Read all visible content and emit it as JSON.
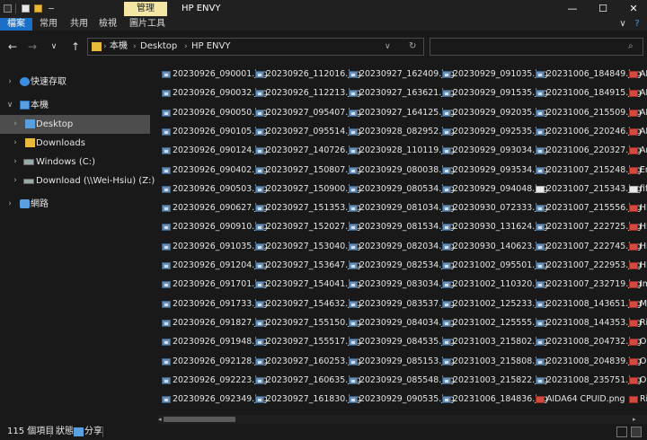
{
  "window": {
    "title": "HP ENVY",
    "manage_tab": "管理",
    "minimize": "—",
    "maximize": "☐",
    "close": "✕"
  },
  "ribbon": {
    "tabs": [
      "檔案",
      "常用",
      "共用",
      "檢視",
      "圖片工具"
    ],
    "expand": "∨",
    "help": "?"
  },
  "nav": {
    "back": "←",
    "forward": "→",
    "recent": "∨",
    "up": "↑",
    "breadcrumbs": [
      "本機",
      "Desktop",
      "HP ENVY"
    ],
    "crumb_sep": "›",
    "dropdown": "∨",
    "refresh": "↻",
    "search_icon": "⌕"
  },
  "sidebar": {
    "items": [
      {
        "label": "快速存取",
        "icon": "star-icon",
        "chevron": "›"
      },
      {
        "label": "本機",
        "icon": "computer-icon",
        "chevron": "∨"
      },
      {
        "label": "Desktop",
        "icon": "folder-icon",
        "chevron": "›"
      },
      {
        "label": "Downloads",
        "icon": "folder-icon",
        "chevron": "›"
      },
      {
        "label": "Windows (C:)",
        "icon": "drive-icon",
        "chevron": "›"
      },
      {
        "label": "Download (\\\\Wei-Hsiu) (Z:)",
        "icon": "network-drive-icon",
        "chevron": "›"
      },
      {
        "label": "網路",
        "icon": "network-icon",
        "chevron": "›"
      }
    ]
  },
  "files": {
    "columns": [
      [
        "20230926_090001.jpg",
        "20230926_090032.jpg",
        "20230926_090050.jpg",
        "20230926_090105.jpg",
        "20230926_090124.jpg",
        "20230926_090402.jpg",
        "20230926_090503.jpg",
        "20230926_090627.jpg",
        "20230926_090910.jpg",
        "20230926_091035.jpg",
        "20230926_091204.jpg",
        "20230926_091701.jpg",
        "20230926_091733.jpg",
        "20230926_091827.jpg",
        "20230926_091948.jpg",
        "20230926_092128.jpg",
        "20230926_092223.jpg",
        "20230926_092349.jpg"
      ],
      [
        "20230926_112016.jpg",
        "20230926_112213.jpg",
        "20230927_095407.jpg",
        "20230927_095514.jpg",
        "20230927_140726.jpg",
        "20230927_150807.jpg",
        "20230927_150900.jpg",
        "20230927_151353.jpg",
        "20230927_152027.jpg",
        "20230927_153040.jpg",
        "20230927_153647.jpg",
        "20230927_154041.jpg",
        "20230927_154632.jpg",
        "20230927_155150.jpg",
        "20230927_155517.jpg",
        "20230927_160253.jpg",
        "20230927_160635.jpg",
        "20230927_161830.jpg"
      ],
      [
        "20230927_162409.jpg",
        "20230927_163621.jpg",
        "20230927_164125.jpg",
        "20230928_082952.jpg",
        "20230928_110119.jpg",
        "20230929_080038.jpg",
        "20230929_080534.jpg",
        "20230929_081034.jpg",
        "20230929_081534.jpg",
        "20230929_082034.jpg",
        "20230929_082534.jpg",
        "20230929_083034.jpg",
        "20230929_083537.jpg",
        "20230929_084034.jpg",
        "20230929_084535.jpg",
        "20230929_085153.jpg",
        "20230929_085548.jpg",
        "20230929_090535.jpg"
      ],
      [
        "20230929_091035.jpg",
        "20230929_091535.jpg",
        "20230929_092035.jpg",
        "20230929_092535.jpg",
        "20230929_093034.jpg",
        "20230929_093534.jpg",
        "20230929_094048.jpg",
        "20230930_072333.jpg",
        "20230930_131624.jpg",
        "20230930_140623.jpg",
        "20231002_095501.jpg",
        "20231002_110320.jpg",
        "20231002_125233.jpg",
        "20231002_125555.jpg",
        "20231003_215802.jpg",
        "20231003_215808.jpg",
        "20231003_215822.jpg",
        "20231006_184836.jpg"
      ],
      [
        "20231006_184849.jpg",
        "20231006_184915.jpg",
        "20231006_215509.jpg",
        "20231006_220246.jpg",
        "20231006_220327.jpg",
        "20231007_215248.jpg",
        "20231007_215343.jpg",
        "20231007_215556.jpg",
        "20231007_222725.jpg",
        "20231007_222745.jpg",
        "20231007_222953.jpg",
        "20231007_232719.jpg",
        "20231008_143651.jpg",
        "20231008_144353.jpg",
        "20231008_204732.jpg",
        "20231008_204839.jpg",
        "20231008_235751.jpg",
        "AIDA64 CPUID.png"
      ],
      [
        "AI",
        "AI",
        "AI",
        "AI",
        "An",
        "En",
        "fifi",
        "HP",
        "HP",
        "HP",
        "HP",
        "Im",
        "Mi",
        "Ri",
        "Op",
        "Op",
        "OS",
        "Ri"
      ]
    ],
    "column_icons": [
      [
        "img",
        "img",
        "img",
        "img",
        "img",
        "img",
        "img",
        "img",
        "img",
        "img",
        "img",
        "img",
        "img",
        "img",
        "img",
        "img",
        "img",
        "img"
      ],
      [
        "img",
        "img",
        "img",
        "img",
        "img",
        "img",
        "img",
        "img",
        "img",
        "img",
        "img",
        "img",
        "img",
        "img",
        "img",
        "img",
        "img",
        "img"
      ],
      [
        "img",
        "img",
        "img",
        "img",
        "img",
        "img",
        "img",
        "img",
        "img",
        "img",
        "img",
        "img",
        "img",
        "img",
        "img",
        "img",
        "img",
        "img"
      ],
      [
        "img",
        "img",
        "img",
        "img",
        "img",
        "img",
        "img",
        "img",
        "img",
        "img",
        "img",
        "img",
        "img",
        "img",
        "img",
        "img",
        "img",
        "img"
      ],
      [
        "img",
        "img",
        "img",
        "img",
        "img",
        "img",
        "txt",
        "img",
        "img",
        "img",
        "img",
        "img",
        "img",
        "img",
        "img",
        "img",
        "img",
        "red"
      ],
      [
        "red",
        "red",
        "red",
        "red",
        "red",
        "red",
        "txt",
        "red",
        "red",
        "red",
        "red",
        "red",
        "red",
        "red",
        "red",
        "red",
        "red",
        "red"
      ]
    ]
  },
  "status": {
    "item_count": "115 個項目",
    "state_label": "狀態:",
    "state_value": "分享"
  },
  "colors": {
    "selected_tab": "#1a6fc6",
    "manage_tab": "#f4e7a6",
    "sidebar_selected": "#4d4d4d"
  }
}
